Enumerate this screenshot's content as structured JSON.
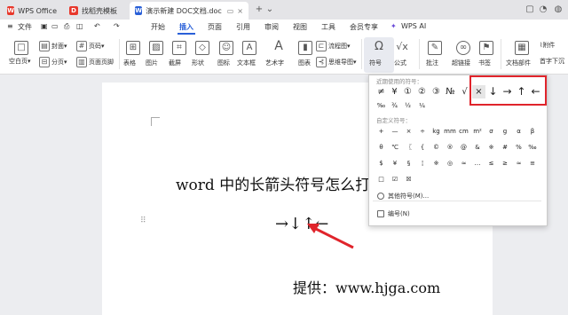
{
  "tabs": [
    {
      "label": "WPS Office",
      "icon": "wps-logo-icon",
      "color": "#e8382c"
    },
    {
      "label": "找稻壳模板",
      "icon": "docer-icon",
      "color": "#e8382c"
    },
    {
      "label": "演示新建 DOC文档.doc",
      "icon": "word-doc-icon",
      "color": "#2a60d8"
    }
  ],
  "menu": {
    "file": "文件",
    "items": [
      "开始",
      "插入",
      "页面",
      "引用",
      "审阅",
      "视图",
      "工具",
      "会员专享"
    ],
    "active": "插入",
    "ai": "WPS AI"
  },
  "toolbar": {
    "row1": [
      "封面",
      "页码",
      "流程图",
      "附件"
    ],
    "row2": [
      "空白页",
      "分页",
      "页面页脚"
    ],
    "groups": [
      "表格",
      "图片",
      "截屏",
      "形状",
      "图标",
      "文本框",
      "艺术字",
      "图表",
      "思维导图",
      "符号",
      "公式",
      "批注",
      "超链接",
      "书签",
      "文档部件",
      "首字下沉"
    ]
  },
  "document": {
    "heading": "word 中的长箭头符号怎么打",
    "arrows": "→↓↑←",
    "credit": "提供：www.hjga.com"
  },
  "panel": {
    "recent_label": "近期使用的符号：",
    "recent": [
      "≠",
      "¥",
      "①",
      "②",
      "③",
      "№",
      "√",
      "×",
      "↓",
      "→",
      "↑",
      "←",
      "‰",
      "¾",
      "½",
      "¼"
    ],
    "custom_label": "自定义符号：",
    "custom_rows": [
      [
        "+",
        "—",
        "×",
        "÷",
        "kg",
        "mm",
        "cm",
        "m²",
        "σ",
        "g",
        "α",
        "β"
      ],
      [
        "θ",
        "℃",
        "〖",
        "{",
        "©",
        "®",
        "@",
        "&",
        "※",
        "#",
        "%",
        "‰"
      ],
      [
        "$",
        "¥",
        "§",
        "¦",
        "※",
        "◎",
        "≈",
        "…",
        "≤",
        "≥",
        "≈",
        "≡"
      ],
      [
        "□",
        "☑",
        "☒"
      ]
    ],
    "more": "其他符号(M)...",
    "numbering": "编号(N)"
  },
  "colors": {
    "accent": "#2a60d8",
    "annotation": "#e0242b"
  }
}
